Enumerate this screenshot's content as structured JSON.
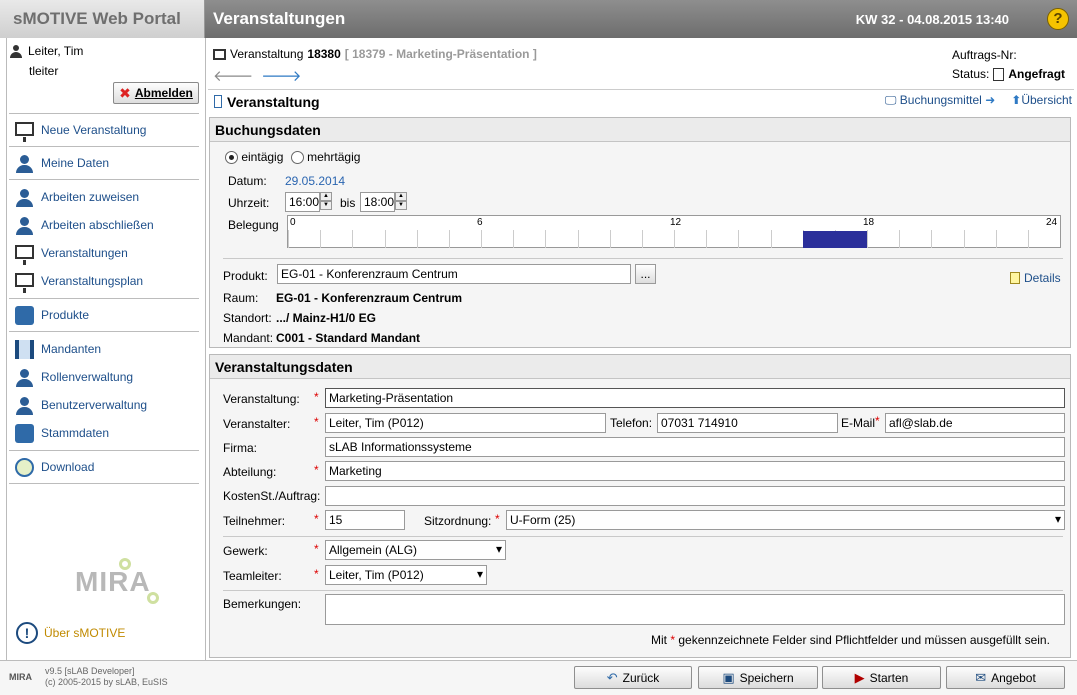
{
  "header": {
    "brand": "sMOTIVE Web Portal",
    "title": "Veranstaltungen",
    "datetime": "KW 32 - 04.08.2015 13:40",
    "help_icon": "?"
  },
  "sidebar": {
    "user_name": "Leiter, Tim",
    "user_login": "tleiter",
    "logout_label": "Abmelden",
    "items": [
      {
        "label": "Neue Veranstaltung",
        "icon": "new-event-icon"
      },
      {
        "label": "Meine Daten",
        "icon": "my-data-icon"
      },
      {
        "label": "Arbeiten zuweisen",
        "icon": "assign-work-icon"
      },
      {
        "label": "Arbeiten abschließen",
        "icon": "complete-work-icon"
      },
      {
        "label": "Veranstaltungen",
        "icon": "events-icon"
      },
      {
        "label": "Veranstaltungsplan",
        "icon": "event-plan-icon"
      },
      {
        "label": "Produkte",
        "icon": "products-icon"
      },
      {
        "label": "Mandanten",
        "icon": "clients-icon"
      },
      {
        "label": "Rollenverwaltung",
        "icon": "roles-icon"
      },
      {
        "label": "Benutzerverwaltung",
        "icon": "users-icon"
      },
      {
        "label": "Stammdaten",
        "icon": "master-data-icon"
      },
      {
        "label": "Download",
        "icon": "download-icon"
      }
    ],
    "logo_text": "MIRA",
    "about_label": "Über sMOTIVE"
  },
  "event": {
    "label": "Veranstaltung",
    "number": "18380",
    "reference": "[ 18379 - Marketing-Präsentation ]",
    "order_label": "Auftrags-Nr:",
    "status_label": "Status:",
    "status_value": "Angefragt"
  },
  "toolbar": {
    "title": "Veranstaltung",
    "link_booking": "Buchungsmittel",
    "link_overview": "Übersicht"
  },
  "booking": {
    "title": "Buchungsdaten",
    "radio_single": "eintägig",
    "radio_multi": "mehrtägig",
    "date_label": "Datum:",
    "date_value": "29.05.2014",
    "time_label": "Uhrzeit:",
    "time_from": "16:00",
    "time_to_label": "bis",
    "time_to": "18:00",
    "occupancy_label": "Belegung",
    "timeline_ticks": [
      "0",
      "6",
      "12",
      "18",
      "24"
    ],
    "occupied_from_hour": 16,
    "occupied_to_hour": 18,
    "product_label": "Produkt:",
    "product_value": "EG-01 - Konferenzraum Centrum",
    "product_browse": "...",
    "details_label": "Details",
    "room_label": "Raum:",
    "room_value": "EG-01 - Konferenzraum Centrum",
    "location_label": "Standort:",
    "location_value": ".../ Mainz-H1/0 EG",
    "client_label": "Mandant:",
    "client_value": "C001 - Standard Mandant"
  },
  "eventdata": {
    "title": "Veranstaltungsdaten",
    "event_label": "Veranstaltung:",
    "event_value": "Marketing-Präsentation",
    "organizer_label": "Veranstalter:",
    "organizer_value": "Leiter, Tim (P012)",
    "phone_label": "Telefon:",
    "phone_value": "07031 714910",
    "email_label": "E-Mail",
    "email_value": "afl@slab.de",
    "company_label": "Firma:",
    "company_value": "sLAB Informationssysteme",
    "department_label": "Abteilung:",
    "department_value": "Marketing",
    "cost_label": "KostenSt./Auftrag:",
    "cost_value": "",
    "participants_label": "Teilnehmer:",
    "participants_value": "15",
    "seating_label": "Sitzordnung:",
    "seating_value": "U-Form (25)",
    "trade_label": "Gewerk:",
    "trade_value": "Allgemein (ALG)",
    "teamlead_label": "Teamleiter:",
    "teamlead_value": "Leiter, Tim (P012)",
    "remarks_label": "Bemerkungen:",
    "remarks_value": "",
    "required_note_pre": "Mit",
    "required_note_post": "gekennzeichnete Felder sind Pflichtfelder und müssen ausgefüllt sein."
  },
  "footer": {
    "logo": "MIRA",
    "version": "v9.5 [sLAB Developer]",
    "copyright": "(c) 2005-2015 by sLAB, EuSIS",
    "btn_back": "Zurück",
    "btn_save": "Speichern",
    "btn_start": "Starten",
    "btn_offer": "Angebot"
  },
  "colors": {
    "header_dark": "#7a7a7a",
    "link": "#1e4f8a",
    "occupied": "#2b2f9a",
    "required": "#dd0000"
  }
}
